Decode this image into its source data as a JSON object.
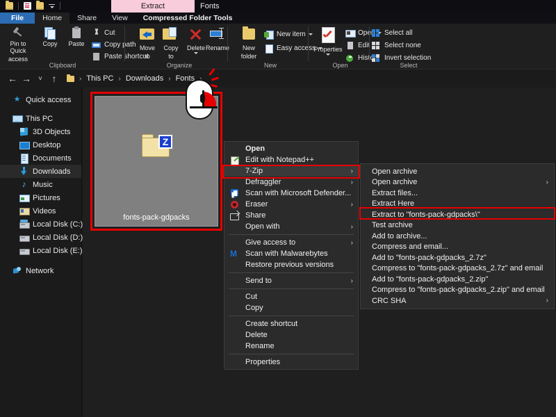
{
  "window": {
    "ribbon_context_tab": "Extract",
    "title": "Fonts"
  },
  "quick_access_toolbar": {
    "items": [
      {
        "name": "folder-icon",
        "label": ""
      },
      {
        "name": "properties-icon",
        "label": ""
      },
      {
        "name": "new-folder-icon",
        "label": ""
      },
      {
        "name": "customize-dropdown-icon",
        "label": ""
      }
    ]
  },
  "ribbon_tabs": [
    {
      "id": "file",
      "label": "File"
    },
    {
      "id": "home",
      "label": "Home"
    },
    {
      "id": "share",
      "label": "Share"
    },
    {
      "id": "view",
      "label": "View"
    },
    {
      "id": "compressed-folder-tools",
      "label": "Compressed Folder Tools"
    }
  ],
  "ribbon": {
    "groups": [
      {
        "id": "clipboard",
        "label": "Clipboard",
        "big_buttons": [
          {
            "id": "pin-to-quick-access",
            "line1": "Pin to Quick",
            "line2": "access",
            "icon": "pin-icon"
          },
          {
            "id": "copy",
            "line1": "Copy",
            "line2": "",
            "icon": "copy-icon"
          },
          {
            "id": "paste",
            "line1": "Paste",
            "line2": "",
            "icon": "paste-icon"
          }
        ],
        "small_buttons": [
          {
            "id": "cut",
            "label": "Cut",
            "icon": "scissors-icon"
          },
          {
            "id": "copy-path",
            "label": "Copy path",
            "icon": "copy-path-icon"
          },
          {
            "id": "paste-shortcut",
            "label": "Paste shortcut",
            "icon": "paste-shortcut-icon"
          }
        ]
      },
      {
        "id": "organize",
        "label": "Organize",
        "big_buttons": [
          {
            "id": "move-to",
            "line1": "Move",
            "line2": "to",
            "icon": "move-to-icon"
          },
          {
            "id": "copy-to",
            "line1": "Copy",
            "line2": "to",
            "icon": "copy-to-icon"
          },
          {
            "id": "delete",
            "line1": "Delete",
            "line2": "",
            "icon": "delete-icon"
          },
          {
            "id": "rename",
            "line1": "Rename",
            "line2": "",
            "icon": "rename-icon"
          }
        ]
      },
      {
        "id": "new",
        "label": "New",
        "big_buttons": [
          {
            "id": "new-folder",
            "line1": "New",
            "line2": "folder",
            "icon": "new-folder-icon"
          }
        ],
        "small_buttons": [
          {
            "id": "new-item",
            "label": "New item",
            "icon": "new-item-icon"
          },
          {
            "id": "easy-access",
            "label": "Easy access",
            "icon": "easy-access-icon"
          }
        ]
      },
      {
        "id": "open",
        "label": "Open",
        "big_buttons": [
          {
            "id": "properties",
            "line1": "Properties",
            "line2": "",
            "icon": "properties-icon"
          }
        ],
        "small_buttons": [
          {
            "id": "open",
            "label": "Open",
            "icon": "open-icon"
          },
          {
            "id": "edit",
            "label": "Edit",
            "icon": "edit-icon"
          },
          {
            "id": "history",
            "label": "History",
            "icon": "history-icon"
          }
        ]
      },
      {
        "id": "select",
        "label": "Select",
        "small_buttons": [
          {
            "id": "select-all",
            "label": "Select all",
            "icon": "select-all-icon"
          },
          {
            "id": "select-none",
            "label": "Select none",
            "icon": "select-none-icon"
          },
          {
            "id": "invert-selection",
            "label": "Invert selection",
            "icon": "invert-selection-icon"
          }
        ]
      }
    ]
  },
  "address_bar": {
    "back_glyph": "←",
    "forward_glyph": "→",
    "recent_glyph": "˅",
    "up_glyph": "↑",
    "breadcrumbs": [
      "This PC",
      "Downloads",
      "Fonts"
    ],
    "separator": "›"
  },
  "sidebar": {
    "items": [
      {
        "id": "quick-access",
        "label": "Quick access",
        "icon": "star-icon",
        "indent": 0,
        "selected": false
      },
      {
        "id": "this-pc",
        "label": "This PC",
        "icon": "pc-icon",
        "indent": 0,
        "selected": false
      },
      {
        "id": "3d-objects",
        "label": "3D Objects",
        "icon": "3d-objects-icon",
        "indent": 1,
        "selected": false
      },
      {
        "id": "desktop",
        "label": "Desktop",
        "icon": "desktop-icon",
        "indent": 1,
        "selected": false
      },
      {
        "id": "documents",
        "label": "Documents",
        "icon": "documents-icon",
        "indent": 1,
        "selected": false
      },
      {
        "id": "downloads",
        "label": "Downloads",
        "icon": "downloads-icon",
        "indent": 1,
        "selected": true
      },
      {
        "id": "music",
        "label": "Music",
        "icon": "music-icon",
        "indent": 1,
        "selected": false
      },
      {
        "id": "pictures",
        "label": "Pictures",
        "icon": "pictures-icon",
        "indent": 1,
        "selected": false
      },
      {
        "id": "videos",
        "label": "Videos",
        "icon": "videos-icon",
        "indent": 1,
        "selected": false
      },
      {
        "id": "local-disk-c",
        "label": "Local Disk (C:)",
        "icon": "disk-system-icon",
        "indent": 1,
        "selected": false
      },
      {
        "id": "local-disk-d",
        "label": "Local Disk (D:)",
        "icon": "disk-icon",
        "indent": 1,
        "selected": false
      },
      {
        "id": "local-disk-e",
        "label": "Local Disk (E:)",
        "icon": "disk-icon",
        "indent": 1,
        "selected": false
      },
      {
        "id": "network",
        "label": "Network",
        "icon": "network-icon",
        "indent": 0,
        "selected": false
      }
    ]
  },
  "file_view": {
    "selected_file": {
      "name": "fonts-pack-gdpacks",
      "icon": "zip-folder-icon",
      "badge_letter": "Z"
    }
  },
  "cursor": {
    "type": "mouse-right-click",
    "highlighted_button": "right",
    "highlight_color": "#e60000"
  },
  "context_menu": {
    "items": [
      {
        "id": "open",
        "label": "Open",
        "bold": true,
        "icon": null,
        "submenu": false
      },
      {
        "id": "edit-with-notepadpp",
        "label": "Edit with Notepad++",
        "bold": false,
        "icon": "notepadpp-icon",
        "submenu": false
      },
      {
        "id": "7-zip",
        "label": "7-Zip",
        "bold": false,
        "icon": null,
        "submenu": true,
        "highlighted": true
      },
      {
        "id": "defraggler",
        "label": "Defraggler",
        "bold": false,
        "icon": null,
        "submenu": true
      },
      {
        "id": "scan-with-microsoft-defender",
        "label": "Scan with Microsoft Defender...",
        "bold": false,
        "icon": "defender-icon",
        "submenu": false
      },
      {
        "id": "eraser",
        "label": "Eraser",
        "bold": false,
        "icon": "eraser-icon",
        "submenu": true
      },
      {
        "id": "share",
        "label": "Share",
        "bold": false,
        "icon": "share-icon",
        "submenu": false
      },
      {
        "id": "open-with",
        "label": "Open with",
        "bold": false,
        "icon": null,
        "submenu": true
      },
      {
        "id": "sep-1",
        "separator": true
      },
      {
        "id": "give-access-to",
        "label": "Give access to",
        "bold": false,
        "icon": null,
        "submenu": true
      },
      {
        "id": "scan-with-malwarebytes",
        "label": "Scan with Malwarebytes",
        "bold": false,
        "icon": "malwarebytes-icon",
        "submenu": false
      },
      {
        "id": "restore-previous-versions",
        "label": "Restore previous versions",
        "bold": false,
        "icon": null,
        "submenu": false
      },
      {
        "id": "sep-2",
        "separator": true
      },
      {
        "id": "send-to",
        "label": "Send to",
        "bold": false,
        "icon": null,
        "submenu": true
      },
      {
        "id": "sep-3",
        "separator": true
      },
      {
        "id": "cut",
        "label": "Cut",
        "bold": false,
        "icon": null,
        "submenu": false
      },
      {
        "id": "copy",
        "label": "Copy",
        "bold": false,
        "icon": null,
        "submenu": false
      },
      {
        "id": "sep-4",
        "separator": true
      },
      {
        "id": "create-shortcut",
        "label": "Create shortcut",
        "bold": false,
        "icon": null,
        "submenu": false
      },
      {
        "id": "delete",
        "label": "Delete",
        "bold": false,
        "icon": null,
        "submenu": false
      },
      {
        "id": "rename",
        "label": "Rename",
        "bold": false,
        "icon": null,
        "submenu": false
      },
      {
        "id": "sep-5",
        "separator": true
      },
      {
        "id": "properties",
        "label": "Properties",
        "bold": false,
        "icon": null,
        "submenu": false
      }
    ]
  },
  "submenu_7zip": {
    "items": [
      {
        "id": "open-archive",
        "label": "Open archive",
        "submenu": false
      },
      {
        "id": "open-archive-sub",
        "label": "Open archive",
        "submenu": true
      },
      {
        "id": "extract-files",
        "label": "Extract files...",
        "submenu": false
      },
      {
        "id": "extract-here",
        "label": "Extract Here",
        "submenu": false
      },
      {
        "id": "extract-to-folder",
        "label": "Extract to \"fonts-pack-gdpacks\\\"",
        "submenu": false,
        "highlighted": true
      },
      {
        "id": "test-archive",
        "label": "Test archive",
        "submenu": false
      },
      {
        "id": "add-to-archive",
        "label": "Add to archive...",
        "submenu": false
      },
      {
        "id": "compress-and-email",
        "label": "Compress and email...",
        "submenu": false
      },
      {
        "id": "add-to-7z",
        "label": "Add to \"fonts-pack-gdpacks_2.7z\"",
        "submenu": false
      },
      {
        "id": "compress-to-7z-email",
        "label": "Compress to \"fonts-pack-gdpacks_2.7z\" and email",
        "submenu": false
      },
      {
        "id": "add-to-zip",
        "label": "Add to \"fonts-pack-gdpacks_2.zip\"",
        "submenu": false
      },
      {
        "id": "compress-to-zip-email",
        "label": "Compress to \"fonts-pack-gdpacks_2.zip\" and email",
        "submenu": false
      },
      {
        "id": "crc-sha",
        "label": "CRC SHA",
        "submenu": true
      }
    ]
  },
  "colors": {
    "accent_blue": "#2b6cb5",
    "highlight_red": "#e60000",
    "context_tab_pink": "#f9ccdc",
    "window_bg": "#1b1b1b",
    "menu_bg": "#2b2b2b"
  },
  "glyphs": {
    "submenu_arrow": "›"
  }
}
